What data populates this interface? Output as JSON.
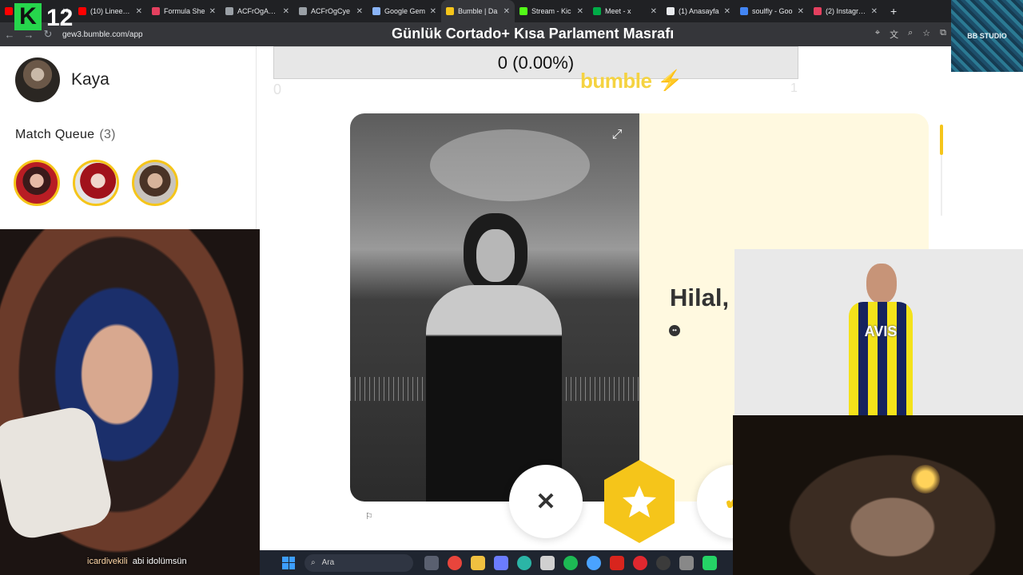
{
  "browser": {
    "tabs": [
      {
        "title": "(10)",
        "color": "#ff0000"
      },
      {
        "title": "(10) Lineer C",
        "color": "#ff0000"
      },
      {
        "title": "Formula She",
        "color": "#e4405f"
      },
      {
        "title": "ACFrOgADTi",
        "color": "#9aa0a6"
      },
      {
        "title": "ACFrOgCye",
        "color": "#9aa0a6"
      },
      {
        "title": "Google Gem",
        "color": "#8ab4f8"
      },
      {
        "title": "Bumble | Da",
        "color": "#f5c51a",
        "active": true
      },
      {
        "title": "Stream - Kic",
        "color": "#53fc18"
      },
      {
        "title": "Meet - x",
        "color": "#00ac47"
      },
      {
        "title": "(1) Anasayfa",
        "color": "#e8eaed"
      },
      {
        "title": "soulfly - Goo",
        "color": "#4285f4"
      },
      {
        "title": "(2) Instagram",
        "color": "#e4405f"
      }
    ],
    "new_tab": "+",
    "url": "gew3.bumble.com/app"
  },
  "overlay": {
    "title": "Günlük Cortado+ Kısa Parlament Masrafı",
    "logo_k": "K",
    "logo_number": "12",
    "studio_logo": "BB STUDIO"
  },
  "sidebar": {
    "user_name": "Kaya",
    "match_queue_label": "Match Queue",
    "match_queue_count": "(3)"
  },
  "main": {
    "subscriber_bar": "0 (0.00%)",
    "counter_left": "0",
    "counter_right": "1",
    "logo": "bumble",
    "profile_name": "Hilal,"
  },
  "actions": {
    "pass_symbol": "✕",
    "like_symbol": "✔"
  },
  "stream": {
    "chat_user": "icardivekili",
    "chat_message": "abi idolümsün",
    "jersey_sponsor": "AVIS"
  },
  "taskbar": {
    "search_placeholder": "Ara"
  },
  "colors": {
    "bumble_yellow": "#f5c51a",
    "info_card_bg": "#fff9e0"
  }
}
